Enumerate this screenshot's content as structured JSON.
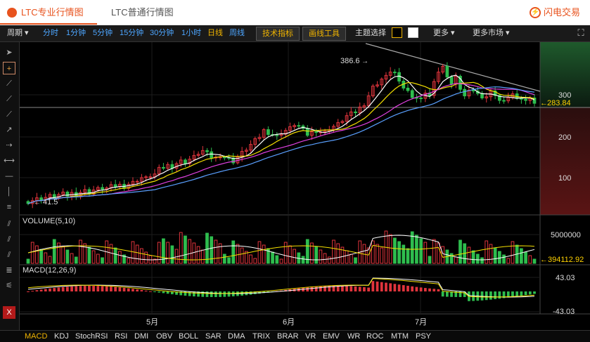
{
  "tabs": {
    "pro": "LTC专业行情图",
    "normal": "LTC普通行情图"
  },
  "brand": {
    "label": "闪电交易"
  },
  "toolbar": {
    "period_label": "周期",
    "periods": [
      "分时",
      "1分钟",
      "5分钟",
      "15分钟",
      "30分钟",
      "1小时",
      "日线",
      "周线"
    ],
    "selected_period": "日线",
    "tech_button": "技术指标",
    "draw_button": "画线工具",
    "theme_label": "主题选择",
    "more": "更多",
    "more_markets": "更多市场"
  },
  "price_axis": {
    "labels": [
      "300",
      "200",
      "100"
    ],
    "current": "283.84"
  },
  "annotations": {
    "high": "386.6",
    "low": "41.5"
  },
  "volume": {
    "title": "VOLUME(5,10)",
    "axis_top": "5000000",
    "current": "394112.92"
  },
  "macd": {
    "title": "MACD(12,26,9)",
    "axis_top": "43.03",
    "axis_bottom": "-43.03"
  },
  "time_axis": [
    "5月",
    "6月",
    "7月"
  ],
  "indicators": [
    "MACD",
    "KDJ",
    "StochRSI",
    "RSI",
    "DMI",
    "OBV",
    "BOLL",
    "SAR",
    "DMA",
    "TRIX",
    "BRAR",
    "VR",
    "EMV",
    "WR",
    "ROC",
    "MTM",
    "PSY"
  ],
  "selected_indicator": "MACD",
  "colors": {
    "up": "#e0343c",
    "down": "#2ebd4e",
    "accent": "#e8531e",
    "selected": "#f0b400",
    "link": "#4da6ff"
  }
}
